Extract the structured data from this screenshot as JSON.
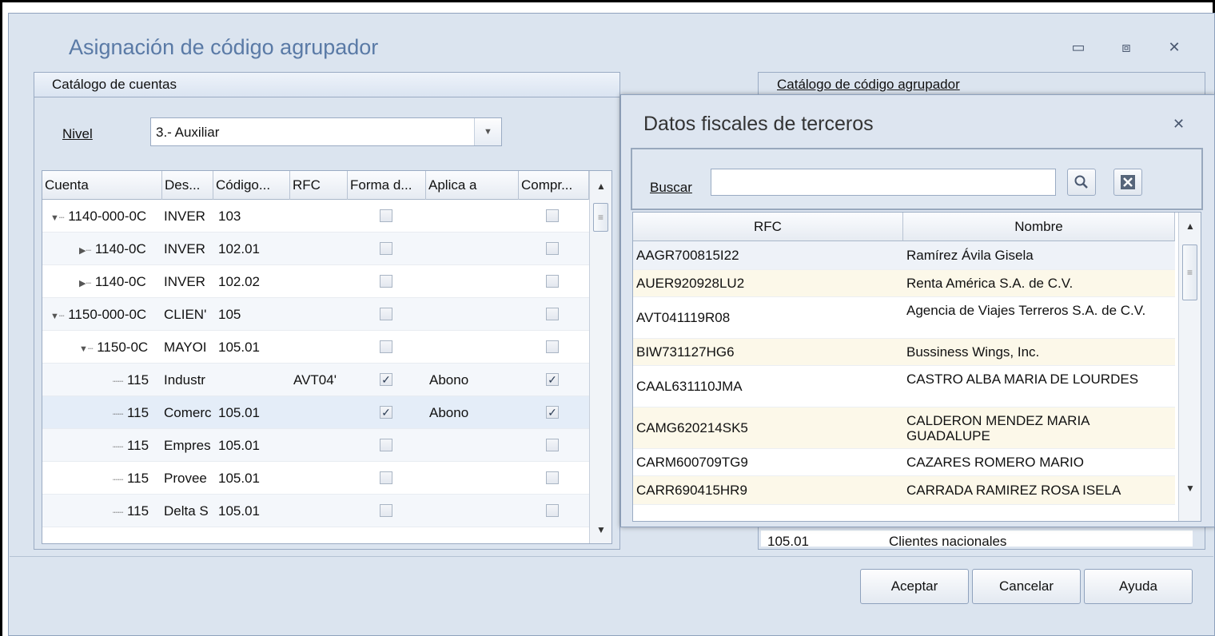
{
  "window": {
    "title": "Asignación de código agrupador",
    "minimize": "▭",
    "maximize": "⧈",
    "close": "✕"
  },
  "left_panel": {
    "header": "Catálogo de cuentas",
    "nivel_label": "Nivel",
    "nivel_value": "3.- Auxiliar",
    "columns": [
      "Cuenta",
      "Des...",
      "Código...",
      "RFC",
      "Forma d...",
      "Aplica a",
      "Compr..."
    ],
    "rows": [
      {
        "cuenta": "1140-000-0C",
        "expander": "▼",
        "desc": "INVER",
        "codigo": "103",
        "rfc": "",
        "forma": false,
        "aplica": "",
        "compr": false
      },
      {
        "cuenta": "1140-0C",
        "expander": "▶",
        "desc": "INVER",
        "codigo": "102.01",
        "rfc": "",
        "forma": false,
        "aplica": "",
        "compr": false
      },
      {
        "cuenta": "1140-0C",
        "expander": "▶",
        "desc": "INVER",
        "codigo": "102.02",
        "rfc": "",
        "forma": false,
        "aplica": "",
        "compr": false
      },
      {
        "cuenta": "1150-000-0C",
        "expander": "▼",
        "desc": "CLIEN'",
        "codigo": "105",
        "rfc": "",
        "forma": false,
        "aplica": "",
        "compr": false
      },
      {
        "cuenta": "1150-0C",
        "expander": "▼",
        "desc": "MAYOI",
        "codigo": "105.01",
        "rfc": "",
        "forma": false,
        "aplica": "",
        "compr": false
      },
      {
        "cuenta": "115",
        "expander": "",
        "desc": "Industr",
        "codigo": "",
        "rfc": "AVT04'",
        "forma": true,
        "aplica": "Abono",
        "compr": true
      },
      {
        "cuenta": "115",
        "expander": "",
        "desc": "Comerc",
        "codigo": "105.01",
        "rfc": "",
        "forma": true,
        "aplica": "Abono",
        "compr": true
      },
      {
        "cuenta": "115",
        "expander": "",
        "desc": "Empres",
        "codigo": "105.01",
        "rfc": "",
        "forma": false,
        "aplica": "",
        "compr": false
      },
      {
        "cuenta": "115",
        "expander": "",
        "desc": "Provee",
        "codigo": "105.01",
        "rfc": "",
        "forma": false,
        "aplica": "",
        "compr": false
      },
      {
        "cuenta": "115",
        "expander": "",
        "desc": "Delta S",
        "codigo": "105.01",
        "rfc": "",
        "forma": false,
        "aplica": "",
        "compr": false
      }
    ]
  },
  "right_panel": {
    "header": "Catálogo de código agrupador",
    "visible_row": {
      "codigo": "105.01",
      "nombre": "Clientes nacionales"
    }
  },
  "popup": {
    "title": "Datos fiscales de terceros",
    "close": "✕",
    "buscar_label": "Buscar",
    "search_value": "",
    "columns": [
      "RFC",
      "Nombre"
    ],
    "rows": [
      {
        "rfc": "AAGR700815I22",
        "nombre": "Ramírez Ávila Gisela"
      },
      {
        "rfc": "AUER920928LU2",
        "nombre": "Renta América S.A. de C.V."
      },
      {
        "rfc": "AVT041119R08",
        "nombre": "Agencia de Viajes Terreros S.A. de C.V."
      },
      {
        "rfc": "BIW731127HG6",
        "nombre": "Bussiness Wings, Inc."
      },
      {
        "rfc": "CAAL631110JMA",
        "nombre": "CASTRO ALBA MARIA DE LOURDES"
      },
      {
        "rfc": "CAMG620214SK5",
        "nombre": "CALDERON MENDEZ MARIA GUADALUPE"
      },
      {
        "rfc": "CARM600709TG9",
        "nombre": "CAZARES ROMERO MARIO"
      },
      {
        "rfc": "CARR690415HR9",
        "nombre": "CARRADA RAMIREZ ROSA ISELA"
      }
    ]
  },
  "buttons": {
    "aceptar": "Aceptar",
    "cancelar": "Cancelar",
    "ayuda": "Ayuda"
  },
  "icons": {
    "search": "search-icon",
    "clear": "clear-icon",
    "check": "✓"
  }
}
